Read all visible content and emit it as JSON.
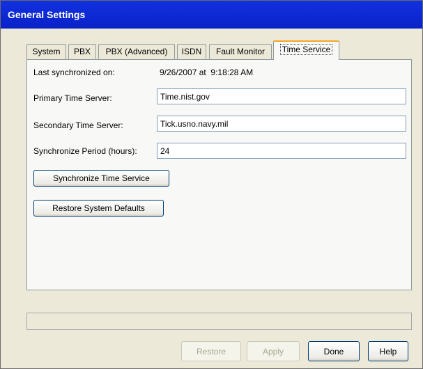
{
  "window": {
    "title": "General Settings"
  },
  "tabs": [
    {
      "label": "System"
    },
    {
      "label": "PBX"
    },
    {
      "label": "PBX (Advanced)"
    },
    {
      "label": "ISDN"
    },
    {
      "label": "Fault Monitor"
    },
    {
      "label": "Time Service",
      "active": true
    }
  ],
  "time_service": {
    "last_sync_label": "Last synchronized on:",
    "last_sync_value": "9/26/2007 at  9:18:28 AM",
    "primary_label": "Primary Time Server:",
    "primary_value": "Time.nist.gov",
    "secondary_label": "Secondary Time Server:",
    "secondary_value": "Tick.usno.navy.mil",
    "period_label": "Synchronize Period (hours):",
    "period_value": "24",
    "sync_button": "Synchronize Time Service",
    "restore_defaults_button": "Restore System Defaults"
  },
  "footer": {
    "status_text": "",
    "restore": "Restore",
    "apply": "Apply",
    "done": "Done",
    "help": "Help"
  }
}
